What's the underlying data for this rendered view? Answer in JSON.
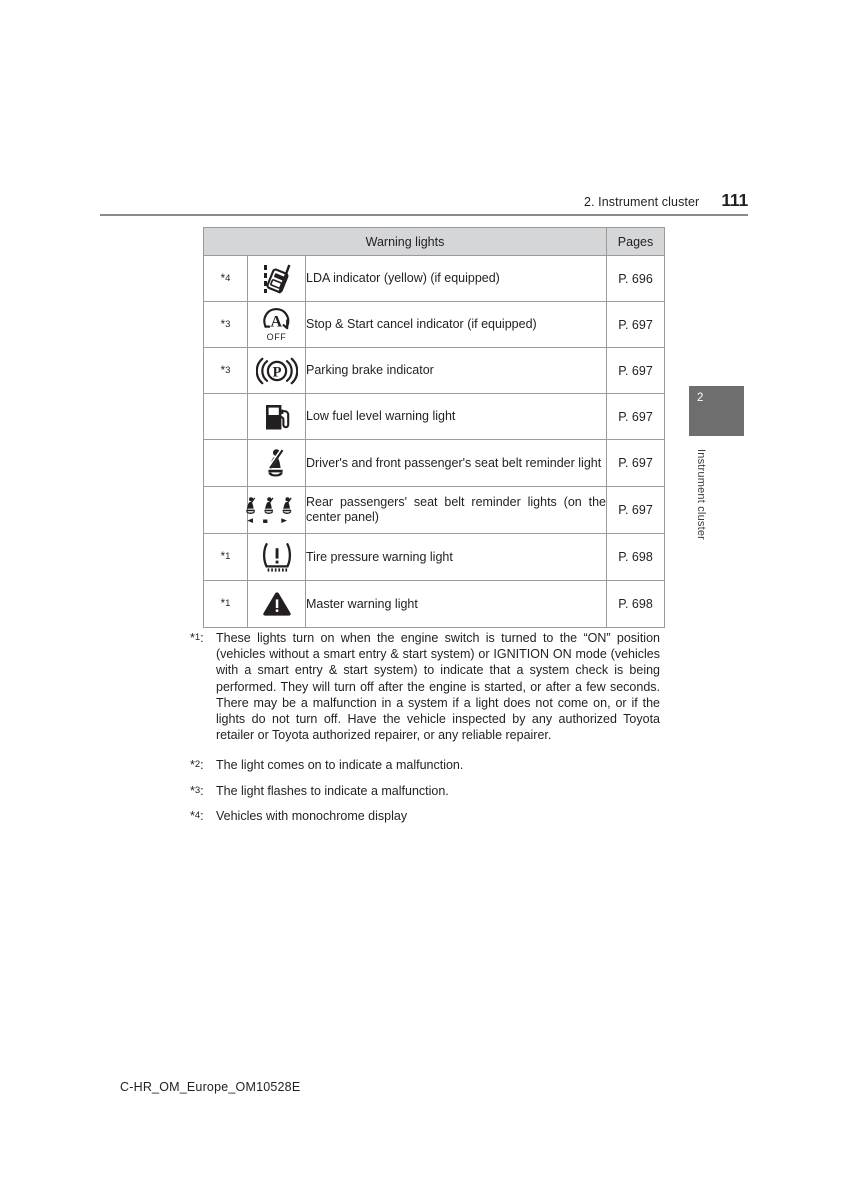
{
  "header": {
    "section_title": "2. Instrument cluster",
    "page_number": "111"
  },
  "chapter_tab": {
    "number": "2",
    "label": "Instrument cluster",
    "color": "#6e6e6e"
  },
  "table": {
    "header_warning_lights": "Warning lights",
    "header_pages": "Pages",
    "header_fill": "#d5d6d8",
    "border_color": "#9b9b9b",
    "rows": [
      {
        "note_star": "*",
        "note_num": "4",
        "icon": "lda-lane-departure-icon",
        "description": "LDA indicator (yellow) (if equipped)",
        "page": "P. 696"
      },
      {
        "note_star": "*",
        "note_num": "3",
        "icon": "stop-start-cancel-icon",
        "icon_sublabel": "OFF",
        "description": "Stop & Start cancel indicator (if equipped)",
        "page": "P. 697"
      },
      {
        "note_star": "*",
        "note_num": "3",
        "icon": "parking-brake-icon",
        "description": "Parking brake indicator",
        "page": "P. 697"
      },
      {
        "note_star": "",
        "note_num": "",
        "icon": "low-fuel-pump-icon",
        "description": "Low fuel level warning light",
        "page": "P. 697"
      },
      {
        "note_star": "",
        "note_num": "",
        "icon": "seat-belt-reminder-icon",
        "description": "Driver's and front passenger's seat belt reminder light",
        "page": "P. 697"
      },
      {
        "note_star": "",
        "note_num": "",
        "icon": "rear-seat-belt-reminder-icon",
        "description": "Rear passengers' seat belt reminder lights (on the center panel)",
        "page": "P. 697"
      },
      {
        "note_star": "*",
        "note_num": "1",
        "icon": "tire-pressure-warning-icon",
        "description": "Tire pressure warning light",
        "page": "P. 698"
      },
      {
        "note_star": "*",
        "note_num": "1",
        "icon": "master-warning-triangle-icon",
        "description": "Master warning light",
        "page": "P. 698"
      }
    ]
  },
  "footnotes": [
    {
      "star": "*",
      "num": "1",
      "colon": ":",
      "text": "These lights turn on when the engine switch is turned to the “ON” position (vehicles without a smart entry & start system) or IGNITION ON mode (vehicles with a smart entry & start system) to indicate that a system check is being performed. They will turn off after the engine is started, or after a few seconds. There may be a malfunction in a system if a light does not come on, or if the lights do not turn off. Have the vehicle inspected by any authorized Toyota retailer or Toyota authorized repairer, or any reliable repairer."
    },
    {
      "star": "*",
      "num": "2",
      "colon": ":",
      "text": "The light comes on to indicate a malfunction."
    },
    {
      "star": "*",
      "num": "3",
      "colon": ":",
      "text": "The light flashes to indicate a malfunction."
    },
    {
      "star": "*",
      "num": "4",
      "colon": ":",
      "text": "Vehicles with monochrome display"
    }
  ],
  "footer": {
    "document_code": "C-HR_OM_Europe_OM10528E"
  }
}
